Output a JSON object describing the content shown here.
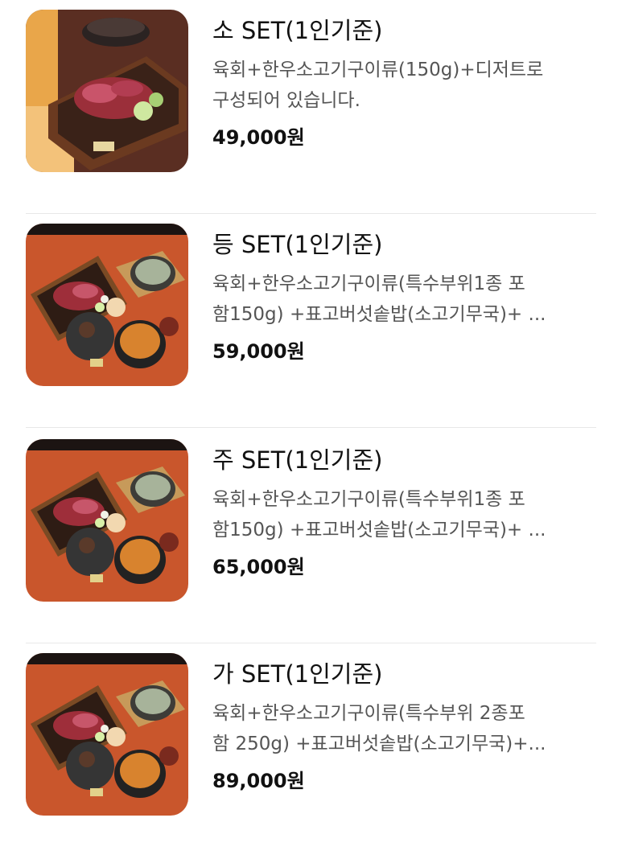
{
  "menu": {
    "items": [
      {
        "title": "소 SET(1인기준)",
        "description": "육회+한우소고기구이류(150g)+디저트로\n구성되어 있습니다.",
        "price": "49,000원",
        "image_icon": "beef-platter-photo-icon"
      },
      {
        "title": "등 SET(1인기준)",
        "description": "육회+한우소고기구이류(특수부위1종 포\n함150g) +표고버섯솥밥(소고기무국)+ ...",
        "price": "59,000원",
        "image_icon": "beef-set-meal-photo-icon"
      },
      {
        "title": "주 SET(1인기준)",
        "description": "육회+한우소고기구이류(특수부위1종 포\n함150g) +표고버섯솥밥(소고기무국)+ ...",
        "price": "65,000원",
        "image_icon": "beef-set-meal-photo-icon"
      },
      {
        "title": "가 SET(1인기준)",
        "description": "육회+한우소고기구이류(특수부위 2종포\n함 250g) +표고버섯솥밥(소고기무국)+...",
        "price": "89,000원",
        "image_icon": "beef-set-meal-photo-icon"
      }
    ]
  },
  "colors": {
    "title": "#111111",
    "description": "#555555",
    "price": "#111111",
    "divider": "#e8e8e8",
    "table_wood": "#c9562c"
  }
}
